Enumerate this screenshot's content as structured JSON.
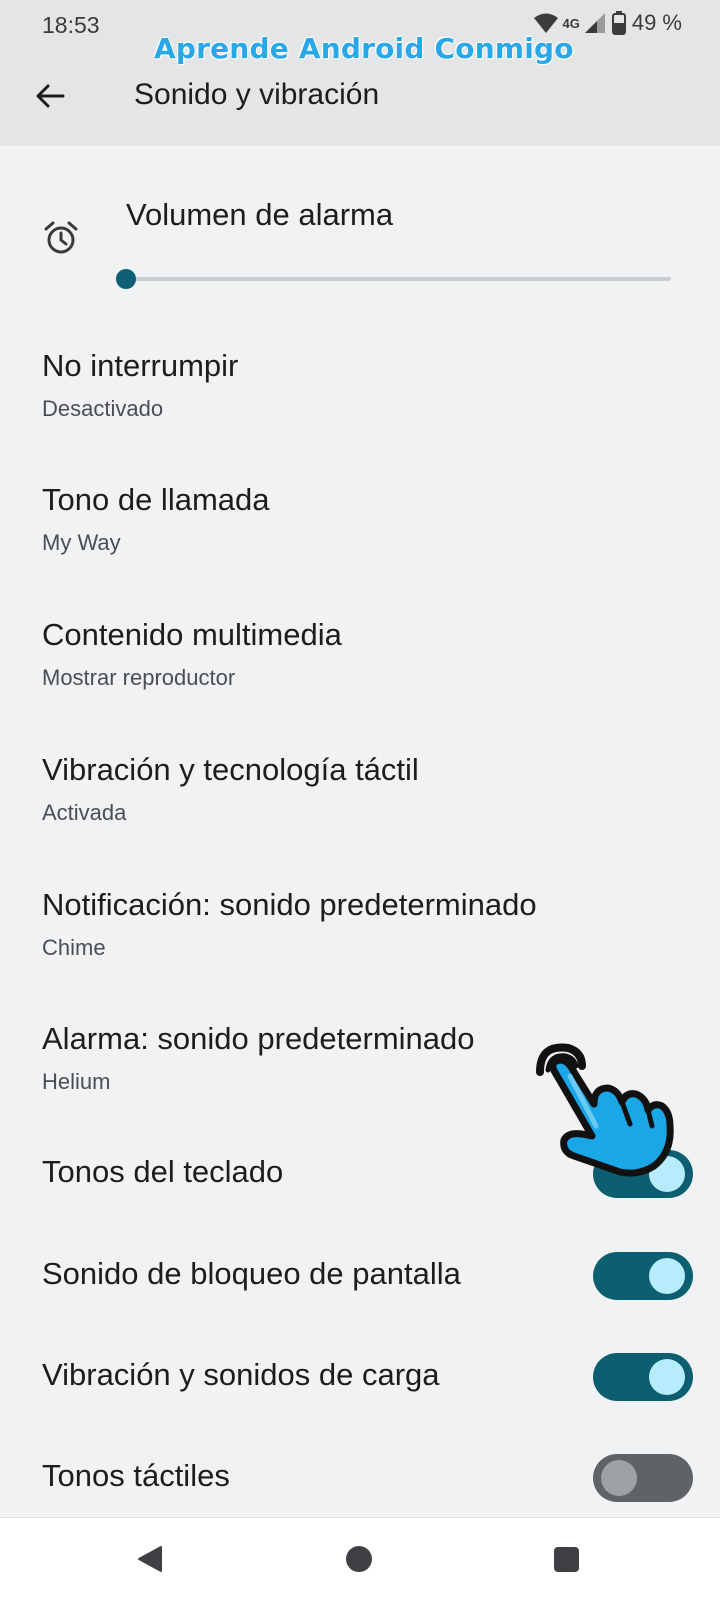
{
  "status_bar": {
    "time": "18:53",
    "network": "4G",
    "battery": "49 %"
  },
  "watermark": "Aprende Android Conmigo",
  "header": {
    "back_icon": "arrow-back-icon",
    "title": "Sonido y vibración"
  },
  "alarm_volume": {
    "label": "Volumen de alarma",
    "icon": "alarm-clock-icon",
    "level": 0
  },
  "settings": [
    {
      "title": "No interrumpir",
      "subtitle": "Desactivado"
    },
    {
      "title": "Tono de llamada",
      "subtitle": "My Way"
    },
    {
      "title": "Contenido multimedia",
      "subtitle": "Mostrar reproductor"
    },
    {
      "title": "Vibración y tecnología táctil",
      "subtitle": "Activada"
    },
    {
      "title": "Notificación: sonido predeterminado",
      "subtitle": "Chime"
    },
    {
      "title": "Alarma: sonido predeterminado",
      "subtitle": "Helium"
    }
  ],
  "toggles": [
    {
      "title": "Tonos del teclado",
      "on": true
    },
    {
      "title": "Sonido de bloqueo de pantalla",
      "on": true
    },
    {
      "title": "Vibración y sonidos de carga",
      "on": true
    },
    {
      "title": "Tonos táctiles",
      "on": false
    }
  ],
  "colors": {
    "accent": "#0c5f71",
    "toggle_knob_on": "#b6ecfb",
    "background": "#f0f2f3",
    "header_bg": "#e3e5e6",
    "watermark": "#29a8e8",
    "pointer_hand": "#1aa7e8"
  },
  "navbar": {
    "back_icon": "nav-back-triangle-icon",
    "home_icon": "nav-home-circle-icon",
    "recents_icon": "nav-recents-square-icon"
  }
}
